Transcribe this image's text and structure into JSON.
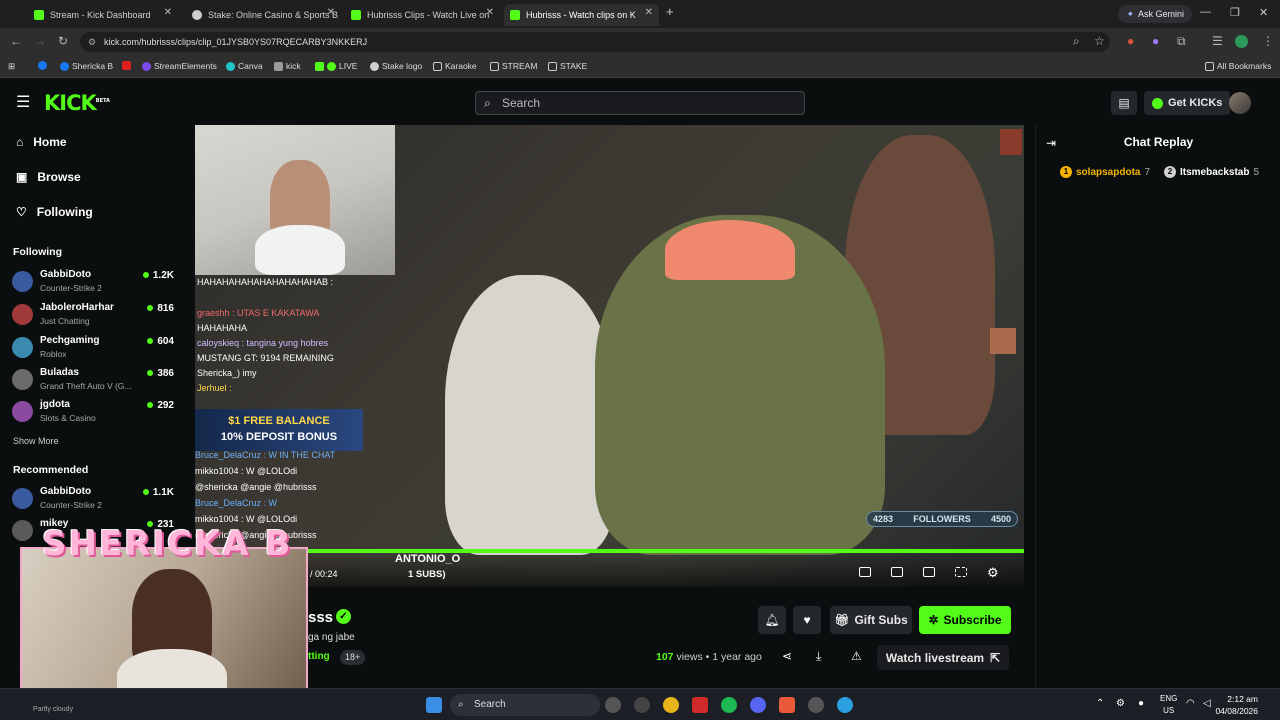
{
  "browser": {
    "tabs": [
      {
        "label": "Stream - Kick Dashboard",
        "color": "#53fc18"
      },
      {
        "label": "Stake: Online Casino & Sports B",
        "color": "#cfcfcf"
      },
      {
        "label": "Hubrisss Clips - Watch Live on",
        "color": "#53fc18"
      },
      {
        "label": "Hubrisss - Watch clips on K",
        "color": "#53fc18"
      }
    ],
    "ask_gemini": "Ask Gemini",
    "url": "kick.com/hubrisss/clips/clip_01JYSB0YS07RQECARBY3NKKERJ",
    "bookmarks": [
      "Shericka B",
      "StreamElements",
      "Canva",
      "kick",
      "LIVE",
      "Stake logo",
      "Karaoke",
      "STREAM",
      "STAKE"
    ],
    "all_bookmarks": "All Bookmarks"
  },
  "header": {
    "logo": "KICK",
    "logo_beta": "BETA",
    "search_placeholder": "Search",
    "get_kicks": "Get KICKs"
  },
  "sidebar": {
    "nav": [
      "Home",
      "Browse",
      "Following"
    ],
    "following_header": "Following",
    "following": [
      {
        "name": "GabbiDoto",
        "category": "Counter-Strike 2",
        "viewers": "1.2K",
        "color": "#3a5aa0"
      },
      {
        "name": "JaboleroHarhar",
        "category": "Just Chatting",
        "viewers": "816",
        "color": "#a03a3a"
      },
      {
        "name": "Pechgaming",
        "category": "Roblox",
        "viewers": "604",
        "color": "#3a8ab0"
      },
      {
        "name": "Buladas",
        "category": "Grand Theft Auto V (G...",
        "viewers": "386",
        "color": "#6a6a6a"
      },
      {
        "name": "jgdota",
        "category": "Slots & Casino",
        "viewers": "292",
        "color": "#8a4aa0"
      }
    ],
    "show_more": "Show More",
    "recommended_header": "Recommended",
    "recommended": [
      {
        "name": "GabbiDoto",
        "category": "Counter-Strike 2",
        "viewers": "1.1K",
        "color": "#3a5aa0"
      },
      {
        "name": "mikey",
        "category": "",
        "viewers": "231",
        "color": "#5a5a5a"
      }
    ]
  },
  "video": {
    "chat_lines": [
      "HAHAHAHAHAHAHAHAHAHAB :",
      "graeshh : UTAS E KAKATAWA",
      "HAHAHAHA",
      "caloyskieq : tangina yung hobres",
      "MUSTANG GT: 9194 REMAINING",
      "Shericka_) imy",
      "Jerhuel :",
      "Bruce_DelaCruz : W IN THE CHAT",
      "mikko1004 : W @LOLOdi",
      "@shericka @angie @hubrisss",
      "Bruce_DelaCruz : W",
      "mikko1004 : W @LOLOdi",
      "@shericka @angie @hubrisss"
    ],
    "promo_line1": "$1 FREE BALANCE",
    "promo_line2": "10% DEPOSIT BONUS",
    "followers_current": "4283",
    "followers_label": "FOLLOWERS",
    "followers_goal": "4500",
    "alert_name": "ANTONIO_O",
    "alert_sub": "1 SUBS)",
    "time": "/ 00:24",
    "progress_fraction": 1.0
  },
  "overlay": {
    "shericka_title": "SHERICKA B"
  },
  "below": {
    "streamer": "sss",
    "clip_title": "ga ng jabe",
    "category": "tting",
    "age_badge": "18+",
    "gift_subs": "Gift Subs",
    "subscribe": "Subscribe",
    "views_count": "107",
    "views_rest": "views • 1 year ago",
    "watch_livestream": "Watch livestream"
  },
  "chat": {
    "title": "Chat Replay",
    "leaders": [
      {
        "rank": "1",
        "name": "solapsapdota",
        "count": "7",
        "color": "#f5b400"
      },
      {
        "rank": "2",
        "name": "Itsmebackstab",
        "count": "5",
        "color": "#cfcfcf"
      }
    ]
  },
  "taskbar": {
    "weather": "Partly cloudy",
    "search": "Search",
    "lang1": "ENG",
    "lang2": "US",
    "time": "2:12 am",
    "date": "04/08/2026"
  }
}
